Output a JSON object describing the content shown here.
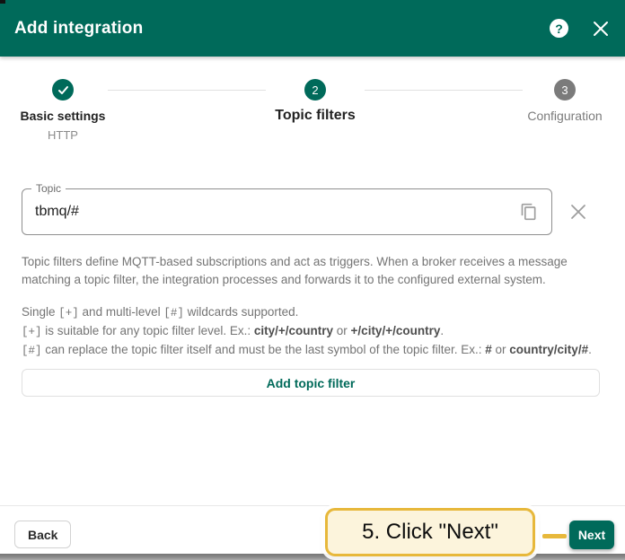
{
  "colors": {
    "accent": "#006A5A",
    "step-inactive": "#7b7b7b",
    "text-secondary": "#747474",
    "annotation-border": "#E7B83B",
    "annotation-bg": "#FCF4DC"
  },
  "header": {
    "title": "Add integration",
    "help_glyph": "?"
  },
  "stepper": {
    "steps": [
      {
        "indicator": "check",
        "label": "Basic settings",
        "sublabel": "HTTP",
        "state": "completed"
      },
      {
        "indicator": "2",
        "label": "Topic filters",
        "sublabel": "",
        "state": "active"
      },
      {
        "indicator": "3",
        "label": "Configuration",
        "sublabel": "",
        "state": "upcoming"
      }
    ]
  },
  "topic_field": {
    "label": "Topic",
    "value": "tbmq/#"
  },
  "intro": {
    "text": "Topic filters define MQTT-based subscriptions and act as triggers. When a broker receives a message matching a topic filter, the integration processes and forwards it to the configured external system."
  },
  "wildcards": {
    "line1": {
      "t1": "Single ",
      "c1": "[+]",
      "t2": " and multi-level ",
      "c2": "[#]",
      "t3": " wildcards supported."
    },
    "line2": {
      "c1": "[+]",
      "t1": " is suitable for any topic filter level. Ex.: ",
      "b1": "city/+/country",
      "t2": " or ",
      "b2": "+/city/+/country",
      "t3": "."
    },
    "line3": {
      "c1": "[#]",
      "t1": " can replace the topic filter itself and must be the last symbol of the topic filter. Ex.: ",
      "b1": "#",
      "t2": " or ",
      "b2": "country/city/#",
      "t3": "."
    }
  },
  "buttons": {
    "add_topic_filter": "Add topic filter",
    "back": "Back",
    "next": "Next"
  },
  "annotation": {
    "text": "5. Click \"Next\"",
    "step_number_shown": "5"
  }
}
